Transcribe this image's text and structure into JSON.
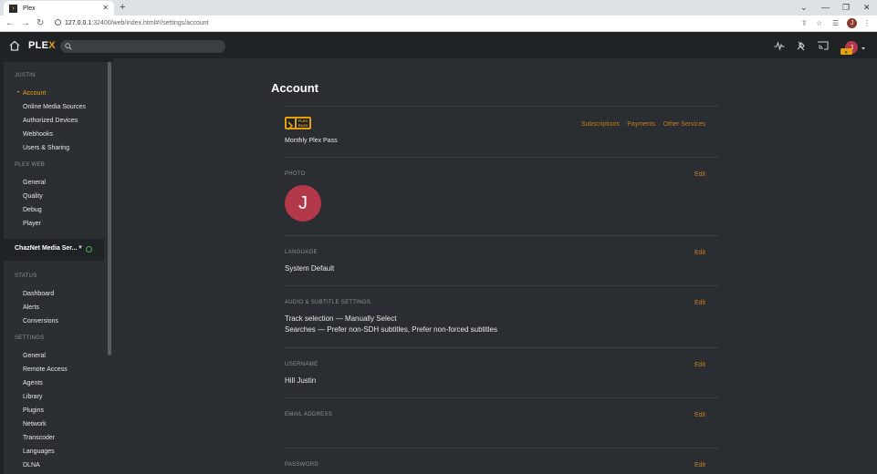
{
  "browser": {
    "tab_title": "Plex",
    "tab_favicon": "›",
    "url_host": "127.0.0.1",
    "url_path": ":32400/web/index.html#!/settings/account",
    "avatar_letter": "J"
  },
  "topbar": {
    "logo_main": "PLE",
    "logo_x": "X",
    "search_placeholder": "",
    "user_letter": "J"
  },
  "sidebar": {
    "user_heading": "JUSTIN",
    "user_items": [
      "Account",
      "Online Media Sources",
      "Authorized Devices",
      "Webhooks",
      "Users & Sharing"
    ],
    "plexweb_heading": "PLEX WEB",
    "plexweb_items": [
      "General",
      "Quality",
      "Debug",
      "Player"
    ],
    "server_name": "ChazNet Media Ser...",
    "status_heading": "STATUS",
    "status_items": [
      "Dashboard",
      "Alerts",
      "Conversions"
    ],
    "settings_heading": "SETTINGS",
    "settings_items": [
      "General",
      "Remote Access",
      "Agents",
      "Library",
      "Plugins",
      "Network",
      "Transcoder",
      "Languages",
      "DLNA"
    ]
  },
  "main": {
    "title": "Account",
    "plexpass": {
      "badge_text": "PLEX PASS",
      "plan": "Monthly Plex Pass",
      "links": [
        "Subscriptions",
        "Payments",
        "Other Services"
      ]
    },
    "photo": {
      "label": "PHOTO",
      "edit": "Edit",
      "avatar_letter": "J"
    },
    "language": {
      "label": "LANGUAGE",
      "edit": "Edit",
      "value": "System Default"
    },
    "audio": {
      "label": "AUDIO & SUBTITLE SETTINGS",
      "edit": "Edit",
      "line1": "Track selection  —  Manually Select",
      "line2": "Searches  —  Prefer non-SDH subtitles, Prefer non-forced subtitles"
    },
    "username": {
      "label": "USERNAME",
      "edit": "Edit",
      "value": "Hill Justin"
    },
    "email": {
      "label": "EMAIL ADDRESS",
      "edit": "Edit"
    },
    "password": {
      "label": "PASSWORD",
      "edit": "Edit"
    }
  },
  "colors": {
    "accent": "#e5a00d",
    "link": "#c57d19",
    "avatar": "#b3394a",
    "status_ok": "#3bb54a"
  }
}
